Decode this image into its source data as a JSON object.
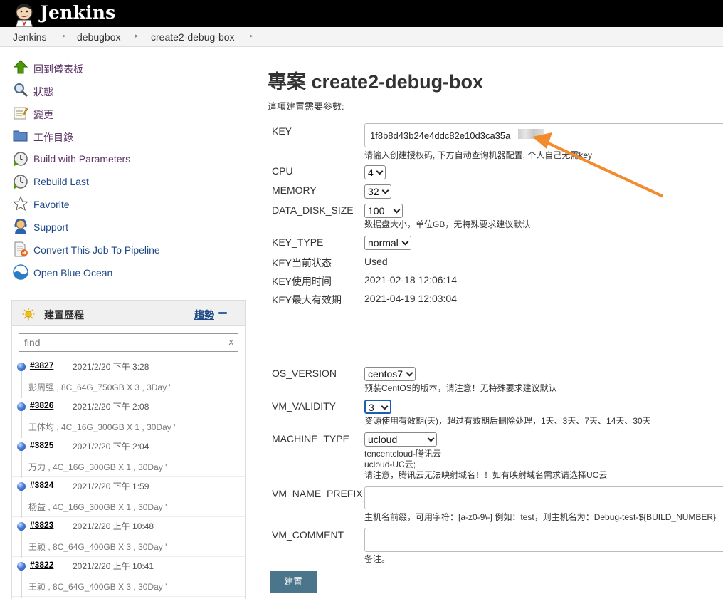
{
  "header": {
    "brand": "Jenkins"
  },
  "breadcrumb": {
    "items": [
      "Jenkins",
      "debugbox",
      "create2-debug-box"
    ]
  },
  "sidebar": {
    "tasks": [
      {
        "label": "回到儀表板",
        "icon": "up-arrow-icon"
      },
      {
        "label": "狀態",
        "icon": "magnifier-icon"
      },
      {
        "label": "變更",
        "icon": "notepad-icon"
      },
      {
        "label": "工作目錄",
        "icon": "folder-icon"
      },
      {
        "label": "Build with Parameters",
        "icon": "clock-play-icon"
      },
      {
        "label": "Rebuild Last",
        "icon": "clock-play-icon"
      },
      {
        "label": "Favorite",
        "icon": "star-icon"
      },
      {
        "label": "Support",
        "icon": "support-person-icon"
      },
      {
        "label": "Convert This Job To Pipeline",
        "icon": "convert-document-icon"
      },
      {
        "label": "Open Blue Ocean",
        "icon": "blue-ocean-icon"
      }
    ]
  },
  "build_history": {
    "title": "建置歷程",
    "trend_label": "趨勢",
    "search_placeholder": "find",
    "clear_label": "x",
    "builds": [
      {
        "number": "#3827",
        "time": "2021/2/20 下午 3:28",
        "desc": "彭周强 , 8C_64G_750GB X 3 , 3Day '"
      },
      {
        "number": "#3826",
        "time": "2021/2/20 下午 2:08",
        "desc": "王体均 , 4C_16G_300GB X 1 , 30Day '"
      },
      {
        "number": "#3825",
        "time": "2021/2/20 下午 2:04",
        "desc": "万力 , 4C_16G_300GB X 1 , 30Day '"
      },
      {
        "number": "#3824",
        "time": "2021/2/20 下午 1:59",
        "desc": "杨益 , 4C_16G_300GB X 1 , 30Day '"
      },
      {
        "number": "#3823",
        "time": "2021/2/20 上午 10:48",
        "desc": "王颖 , 8C_64G_400GB X 3 , 30Day '"
      },
      {
        "number": "#3822",
        "time": "2021/2/20 上午 10:41",
        "desc": "王颖 , 8C_64G_400GB X 3 , 30Day '"
      }
    ]
  },
  "main": {
    "title": "專案 create2-debug-box",
    "subtitle": "這項建置需要參數:",
    "params": {
      "key": {
        "label": "KEY",
        "value": "1f8b8d43b24e4ddc82e10d3ca35a",
        "desc": "请输入创建授权码, 下方自动查询机器配置, 个人自己无需key"
      },
      "cpu": {
        "label": "CPU",
        "value": "4"
      },
      "memory": {
        "label": "MEMORY",
        "value": "32"
      },
      "data_disk": {
        "label": "DATA_DISK_SIZE",
        "value": "100",
        "desc": "数据盘大小，单位GB，无特殊要求建议默认"
      },
      "key_type": {
        "label": "KEY_TYPE",
        "value": "normal"
      },
      "key_status": {
        "label": "KEY当前状态",
        "value": "Used"
      },
      "key_used_time": {
        "label": "KEY使用时间",
        "value": "2021-02-18 12:06:14"
      },
      "key_max_validity": {
        "label": "KEY最大有效期",
        "value": "2021-04-19 12:03:04"
      },
      "os_version": {
        "label": "OS_VERSION",
        "value": "centos7",
        "desc": "预装CentOS的版本，请注意！无特殊要求建议默认"
      },
      "vm_validity": {
        "label": "VM_VALIDITY",
        "value": "3",
        "desc": "资源使用有效期(天)，超过有效期后删除处理，1天、3天、7天、14天、30天"
      },
      "machine_type": {
        "label": "MACHINE_TYPE",
        "value": "ucloud",
        "desc_lines": [
          "tencentcloud-腾讯云",
          "ucloud-UC云;",
          "请注意，腾讯云无法映射域名！！如有映射域名需求请选择UC云"
        ]
      },
      "vm_name_prefix": {
        "label": "VM_NAME_PREFIX",
        "value": "",
        "desc": "主机名前缀，可用字符：[a-z0-9\\-] 例如：test，则主机名为：Debug-test-${BUILD_NUMBER}"
      },
      "vm_comment": {
        "label": "VM_COMMENT",
        "value": "",
        "desc": "备注。"
      }
    },
    "submit_label": "建置"
  },
  "colors": {
    "header_bg": "#000000",
    "link": "#204a87",
    "submit_bg": "#4b758b",
    "annotation_arrow": "#f28a2e"
  }
}
